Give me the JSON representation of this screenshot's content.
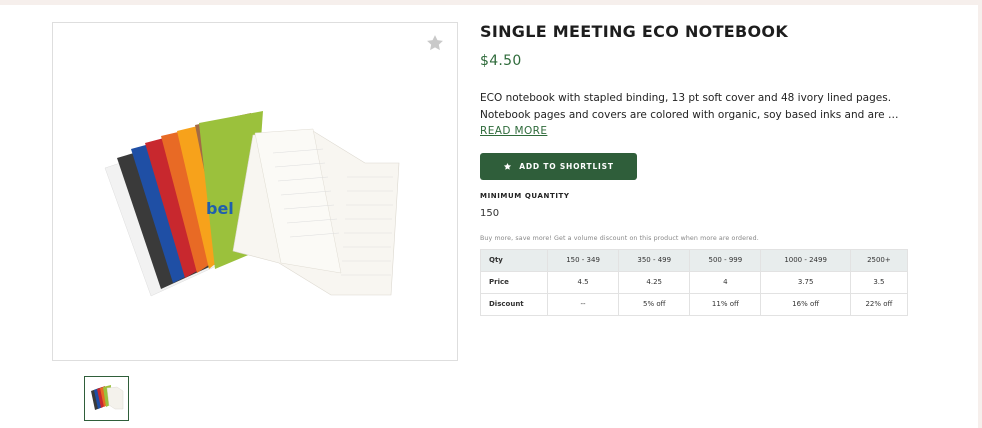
{
  "product": {
    "title": "SINGLE MEETING ECO NOTEBOOK",
    "price": "$4.50",
    "description_line1": "ECO notebook with stapled binding, 13 pt soft cover and 48 ivory lined pages.",
    "description_line2": "Notebook pages and covers are colored with organic, soy based inks and are made i...",
    "read_more": "READ MORE",
    "image_logo_text": "bel",
    "cover_colors": [
      "#f2f2f2",
      "#3a3a3a",
      "#1f4fa5",
      "#c8282e",
      "#e86a25",
      "#f7a21b",
      "#9bc13c"
    ]
  },
  "actions": {
    "shortlist_label": "ADD TO SHORTLIST"
  },
  "minimum": {
    "label": "MINIMUM QUANTITY",
    "value": "150"
  },
  "volume": {
    "note": "Buy more, save more! Get a volume discount on this product when more are ordered.",
    "headers": [
      "Qty",
      "150 - 349",
      "350 - 499",
      "500 - 999",
      "1000 - 2499",
      "2500+"
    ],
    "price_row": [
      "Price",
      "4.5",
      "4.25",
      "4",
      "3.75",
      "3.5"
    ],
    "discount_row": [
      "Discount",
      "--",
      "5% off",
      "11% off",
      "16% off",
      "22% off"
    ]
  },
  "icons": {
    "favorite": "star-icon",
    "shortlist": "star-icon"
  },
  "colors": {
    "accent": "#2f5e3a",
    "price": "#2f6b3b",
    "table_header": "#e8eded"
  }
}
